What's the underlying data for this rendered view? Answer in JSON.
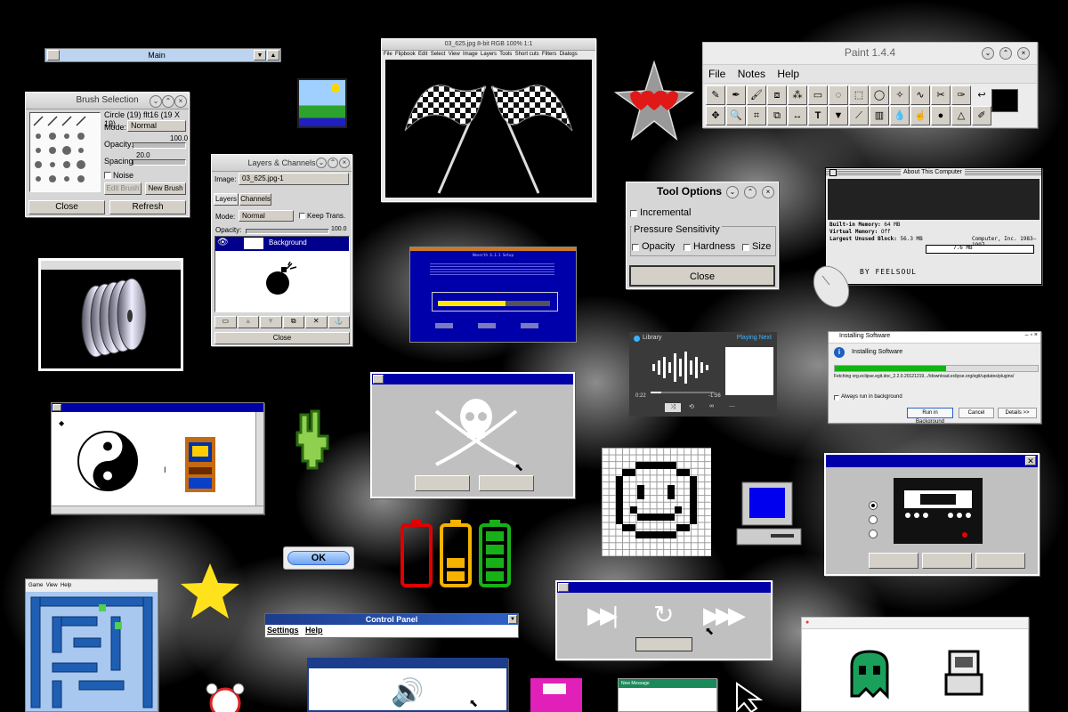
{
  "main_bar": {
    "title": "Main"
  },
  "brush_selection": {
    "title": "Brush Selection",
    "brush_info": "Circle (19) flt16",
    "brush_size": "(19 X 19)",
    "mode_label": "Mode:",
    "mode_value": "Normal",
    "opacity_label": "Opacity:",
    "opacity_value": "100.0",
    "spacing_label": "Spacing:",
    "spacing_value": "20.0",
    "noise_label": "Noise",
    "edit_brush": "Edit Brush",
    "new_brush": "New Brush",
    "close": "Close",
    "refresh": "Refresh"
  },
  "image_window": {
    "title": "03_625.jpg 8-bit RGB 100% 1:1",
    "menu": [
      "File",
      "Flipbook",
      "Edit",
      "Select",
      "View",
      "Image",
      "Layers",
      "Tools",
      "Short cuts",
      "Filters",
      "Dialogs"
    ]
  },
  "paint": {
    "title": "Paint 1.4.4",
    "menu": [
      "File",
      "Notes",
      "Help"
    ]
  },
  "layers": {
    "title": "Layers & Channels",
    "image_label": "Image:",
    "image_value": "03_625.jpg-1",
    "tabs": [
      "Layers",
      "Channels"
    ],
    "mode_label": "Mode:",
    "mode_value": "Normal",
    "keep_trans": "Keep Trans.",
    "opacity_label": "Opacity:",
    "opacity_value": "100.0",
    "layer_name": "Background",
    "close": "Close"
  },
  "tool_options": {
    "title": "Tool Options",
    "incremental": "Incremental",
    "pressure": "Pressure Sensitivity",
    "opacity": "Opacity",
    "hardness": "Hardness",
    "size": "Size",
    "close": "Close"
  },
  "about": {
    "title": "About This Computer",
    "builtin_label": "Built-in Memory:",
    "builtin_value": "64 MB",
    "virtual_label": "Virtual Memory:",
    "virtual_value": "Off",
    "largest_label": "Largest Unused Block:",
    "largest_value": "56.3 MB",
    "copyright": "Computer, Inc. 1983–1997",
    "bar_value": "7.6 MB",
    "credit": "BY FEELSOUL"
  },
  "installer": {
    "title": "Installing Software",
    "heading": "Installing Software",
    "fetching": "Fetching org.eclipse.egit.doc_2.2.0.20121219...//download.eclipse.org/egit/updates/plugins/",
    "always_bg": "Always run in background",
    "run_bg": "Run in Background",
    "cancel": "Cancel",
    "details": "Details >>",
    "progress": 0.55
  },
  "library": {
    "title": "Library",
    "playing_next": "Playing Next",
    "time_elapsed": "0:22",
    "time_left": "-1:56",
    "progress": 0.17
  },
  "blue_setup": {
    "title": "Neverth 4.1.1 Setup",
    "progress": 0.6
  },
  "ok_button": {
    "label": "OK"
  },
  "control_panel": {
    "title": "Control Panel",
    "menu": [
      "Settings",
      "Help"
    ]
  },
  "batteries": {
    "levels": [
      0.0,
      0.5,
      1.0
    ],
    "colors": [
      "#e00000",
      "#f5b300",
      "#18b018"
    ]
  },
  "mini_game": {
    "menu": [
      "Game",
      "View",
      "Help"
    ]
  },
  "new_message": {
    "title": "New Message"
  },
  "colors": {
    "accent_blue": "#0000a8",
    "dialog_gray": "#c0c0c0"
  }
}
